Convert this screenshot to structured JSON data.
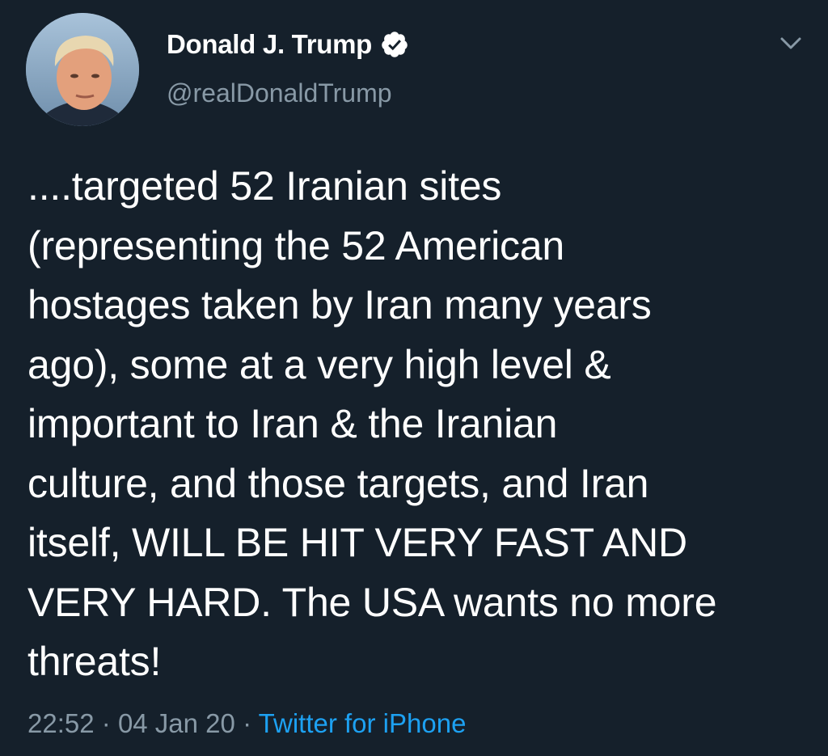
{
  "author": {
    "display_name": "Donald J. Trump",
    "handle": "@realDonaldTrump",
    "verified": true,
    "verified_icon": "verified-badge-icon"
  },
  "tweet": {
    "text": "....targeted 52 Iranian sites\n(representing the 52 American\nhostages taken by Iran many years\nago), some at a very high level &\nimportant to Iran &  the Iranian\nculture, and those targets, and Iran\nitself, WILL BE HIT VERY FAST AND\nVERY HARD. The USA wants no more\nthreats!",
    "time": "22:52",
    "separator": "·",
    "date": "04 Jan 20",
    "source": "Twitter for iPhone"
  },
  "colors": {
    "background": "#15202b",
    "text": "#ffffff",
    "muted": "#8899a6",
    "accent": "#1da1f2"
  },
  "icons": {
    "menu": "chevron-down-icon",
    "avatar": "avatar"
  }
}
